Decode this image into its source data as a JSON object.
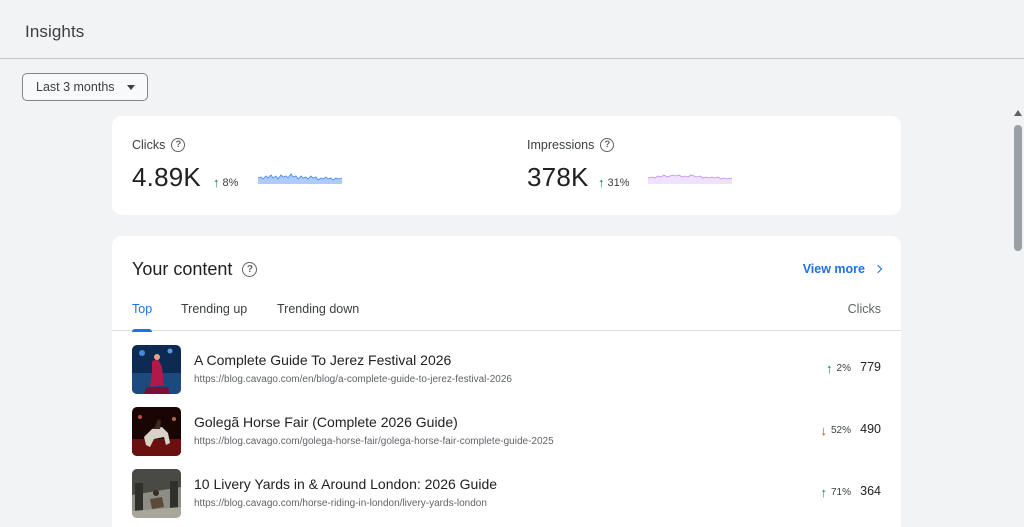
{
  "header": {
    "title": "Insights"
  },
  "filter": {
    "range_label": "Last 3 months"
  },
  "metrics": [
    {
      "label": "Clicks",
      "value": "4.89K",
      "change": "8%",
      "direction": "up",
      "spark_color": "#aecbfa",
      "spark_stroke": "#4285f4"
    },
    {
      "label": "Impressions",
      "value": "378K",
      "change": "31%",
      "direction": "up",
      "spark_color": "#e9d7fb",
      "spark_stroke": "#a142f4"
    }
  ],
  "content": {
    "title": "Your content",
    "view_more": "View more",
    "tabs": [
      {
        "label": "Top",
        "active": true
      },
      {
        "label": "Trending up",
        "active": false
      },
      {
        "label": "Trending down",
        "active": false
      }
    ],
    "column_header": "Clicks",
    "rows": [
      {
        "title": "A Complete Guide To Jerez Festival 2026",
        "url": "https://blog.cavago.com/en/blog/a-complete-guide-to-jerez-festival-2026",
        "change": "2%",
        "direction": "up",
        "clicks": "779"
      },
      {
        "title": "Golegã Horse Fair (Complete 2026 Guide)",
        "url": "https://blog.cavago.com/golega-horse-fair/golega-horse-fair-complete-guide-2025",
        "change": "52%",
        "direction": "down",
        "clicks": "490"
      },
      {
        "title": "10 Livery Yards in & Around London: 2026 Guide",
        "url": "https://blog.cavago.com/horse-riding-in-london/livery-yards-london",
        "change": "71%",
        "direction": "up",
        "clicks": "364"
      }
    ]
  },
  "colors": {
    "accent": "#1a73e8",
    "up": "#188038",
    "down": "#d93025"
  }
}
